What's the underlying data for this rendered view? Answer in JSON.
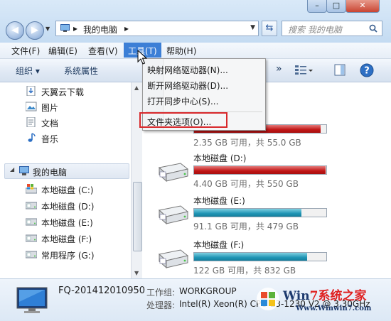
{
  "window": {
    "controls": {
      "minimize": "–",
      "maximize": "□",
      "close": "✕"
    }
  },
  "address": {
    "segments": [
      "我的电脑"
    ],
    "search_placeholder": "搜索 我的电脑"
  },
  "menubar": {
    "items": [
      "文件(F)",
      "编辑(E)",
      "查看(V)",
      "工具(T)",
      "帮助(H)"
    ],
    "active_index": 3
  },
  "toolbar": {
    "organize": "组织 ▾",
    "system_properties": "系统属性",
    "overflow": "»"
  },
  "tools_menu": {
    "items": [
      "映射网络驱动器(N)...",
      "断开网络驱动器(D)...",
      "打开同步中心(S)...",
      "文件夹选项(O)..."
    ],
    "highlighted_index": 3
  },
  "navpane": {
    "favorites": [
      {
        "label": "天翼云下载",
        "icon": "download-icon"
      },
      {
        "label": "图片",
        "icon": "pictures-icon"
      },
      {
        "label": "文档",
        "icon": "documents-icon"
      },
      {
        "label": "音乐",
        "icon": "music-icon"
      }
    ],
    "computer": {
      "label": "我的电脑",
      "icon": "computer-icon"
    },
    "drives": [
      {
        "label": "本地磁盘 (C:)",
        "icon": "windows-drive-icon"
      },
      {
        "label": "本地磁盘 (D:)",
        "icon": "drive-icon"
      },
      {
        "label": "本地磁盘 (E:)",
        "icon": "drive-icon"
      },
      {
        "label": "本地磁盘 (F:)",
        "icon": "drive-icon"
      },
      {
        "label": "常用程序 (G:)",
        "icon": "drive-icon"
      }
    ]
  },
  "drives": [
    {
      "name": "",
      "size": "2.35 GB 可用，共 55.0 GB",
      "used_fraction": 0.957,
      "color": "red"
    },
    {
      "name": "本地磁盘 (D:)",
      "size": "4.40 GB 可用，共 550 GB",
      "used_fraction": 0.992,
      "color": "red"
    },
    {
      "name": "本地磁盘 (E:)",
      "size": "91.1 GB 可用，共 479 GB",
      "used_fraction": 0.81,
      "color": "blue"
    },
    {
      "name": "本地磁盘 (F:)",
      "size": "122 GB 可用，共 832 GB",
      "used_fraction": 0.853,
      "color": "blue"
    }
  ],
  "details": {
    "pc_name": "FQ-201412010950",
    "workgroup_label": "工作组:",
    "workgroup_value": "WORKGROUP",
    "cpu_label": "处理器:",
    "cpu_value": "Intel(R) Xeon(R) CPU E3-1230 V2 @ 3.30GHz"
  },
  "watermark": {
    "title_a": "Win",
    "title_b": "7系统之家",
    "url": "Www.Winwin7.com"
  },
  "colors": {
    "accent": "#3c7fd6",
    "drive_full": "#c11616",
    "drive_ok": "#1f94b4",
    "highlight_box": "#d8282b"
  }
}
